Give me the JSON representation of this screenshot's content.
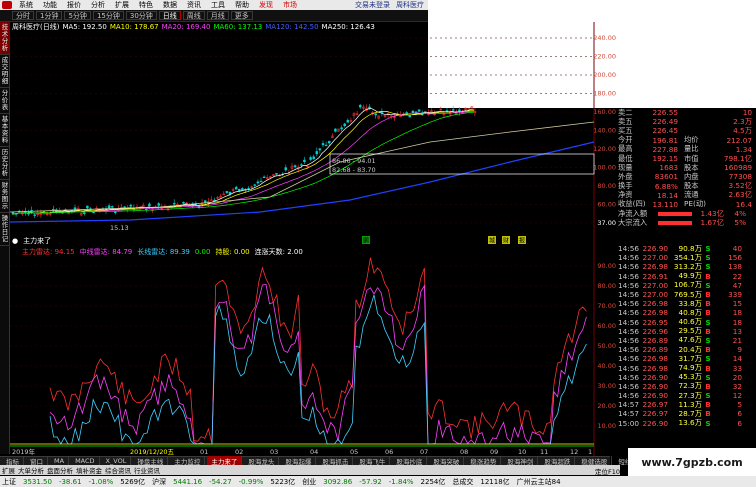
{
  "menu": {
    "items": [
      "系统",
      "功能",
      "报价",
      "分析",
      "扩展",
      "特色",
      "数据",
      "资讯",
      "工具",
      "帮助",
      "发现",
      "市场"
    ],
    "hot_items": [
      "发现",
      "市场"
    ],
    "right": [
      "交易未登录",
      "周科医疗"
    ]
  },
  "toolbar": {
    "periods": [
      "分时",
      "1分钟",
      "5分钟",
      "15分钟",
      "30分钟",
      "日线",
      "周线",
      "月线",
      "更多"
    ],
    "active": "日线"
  },
  "left_tabs": [
    "技术分析",
    "成交明细",
    "分价表",
    "基本资料",
    "历史分析",
    "财务图示",
    "操作日记"
  ],
  "price_legend": {
    "name": "周科医疗(日线)",
    "ma5": "MA5: 192.50",
    "ma10": "MA10: 178.67",
    "ma20": "MA20: 169.40",
    "ma60": "MA60: 137.13",
    "ma120": "MA120: 142.50",
    "ma250": "MA250: 126.43"
  },
  "price_axis": [
    "240.00",
    "220.00",
    "200.00",
    "180.00",
    "160.00",
    "140.00",
    "120.00",
    "100.00",
    "80.00",
    "60.00",
    "37.00"
  ],
  "annotations": [
    "86.86 - 94.01",
    "82.68 - 83.70",
    "15.13"
  ],
  "indicator_legend": {
    "title": "主力来了",
    "items": [
      {
        "label": "主力雷达:",
        "value": "94.15",
        "color": "#ff3030"
      },
      {
        "label": "中线雷达:",
        "value": "84.79",
        "color": "#ff40ff"
      },
      {
        "label": "长线雷达:",
        "value": "89.39",
        "color": "#40d0ff"
      },
      {
        "label": "0.00",
        "value": "",
        "color": "#00ff00"
      },
      {
        "label": "持股:",
        "value": "0.00",
        "color": "#ffff00"
      },
      {
        "label": "连涨天数:",
        "value": "2.00",
        "color": "#ffffff"
      }
    ],
    "markers": [
      "鹏",
      "城",
      "财",
      "报"
    ]
  },
  "indicator_axis": [
    "90.00",
    "80.00",
    "70.00",
    "60.00",
    "50.00",
    "40.00",
    "30.00",
    "20.00",
    "10.00"
  ],
  "date_labels": [
    "2019年",
    "2019/12/20五",
    "01",
    "02",
    "03",
    "04",
    "05",
    "06",
    "07",
    "08",
    "09",
    "10",
    "11",
    "12",
    "1"
  ],
  "quote": {
    "rows": [
      {
        "k": "卖二",
        "v1": "226.55",
        "v2": "10"
      },
      {
        "k": "卖五",
        "v1": "226.49",
        "v2": "2.3万"
      },
      {
        "k": "买五",
        "v1": "226.45",
        "v2": "4.5万"
      },
      {
        "k": "今开",
        "v1": "196.81",
        "k2": "均价",
        "v2": "212.07"
      },
      {
        "k": "最高",
        "v1": "227.88",
        "k2": "量比",
        "v2": "1.34"
      },
      {
        "k": "最低",
        "v1": "192.15",
        "k2": "市值",
        "v2": "798.1亿"
      },
      {
        "k": "现量",
        "v1": "1683",
        "k2": "股本",
        "v2": "160989"
      },
      {
        "k": "外盘",
        "v1": "83601",
        "k2": "内盘",
        "v2": "77308"
      },
      {
        "k": "换手",
        "v1": "6.88%",
        "k2": "股本",
        "v2": "3.52亿"
      },
      {
        "k": "净资",
        "v1": "18.14",
        "k2": "流通",
        "v2": "2.63亿"
      },
      {
        "k": "收益(四)",
        "v1": "13.110",
        "k2": "PE(动)",
        "v2": "16.4"
      }
    ],
    "flow": [
      {
        "k": "净流入额",
        "v": "1.43亿",
        "pct": "4%"
      },
      {
        "k": "大宗流入",
        "v": "1.67亿",
        "pct": "5%"
      }
    ]
  },
  "trades": [
    {
      "t": "14:56",
      "p": "226.90",
      "v": "90.8万",
      "d": "S",
      "n": "40"
    },
    {
      "t": "14:56",
      "p": "227.00",
      "v": "354.1万",
      "d": "S",
      "n": "156"
    },
    {
      "t": "14:56",
      "p": "226.98",
      "v": "313.2万",
      "d": "S",
      "n": "138"
    },
    {
      "t": "14:56",
      "p": "226.91",
      "v": "49.9万",
      "d": "B",
      "n": "22"
    },
    {
      "t": "14:56",
      "p": "227.00",
      "v": "106.7万",
      "d": "S",
      "n": "47"
    },
    {
      "t": "14:56",
      "p": "227.00",
      "v": "769.5万",
      "d": "B",
      "n": "339"
    },
    {
      "t": "14:56",
      "p": "226.98",
      "v": "33.8万",
      "d": "B",
      "n": "15"
    },
    {
      "t": "14:56",
      "p": "226.98",
      "v": "40.8万",
      "d": "B",
      "n": "18"
    },
    {
      "t": "14:56",
      "p": "226.95",
      "v": "40.6万",
      "d": "S",
      "n": "18"
    },
    {
      "t": "14:56",
      "p": "226.96",
      "v": "29.5万",
      "d": "B",
      "n": "13"
    },
    {
      "t": "14:56",
      "p": "226.89",
      "v": "47.6万",
      "d": "S",
      "n": "21"
    },
    {
      "t": "14:56",
      "p": "226.89",
      "v": "20.4万",
      "d": "B",
      "n": "9"
    },
    {
      "t": "14:56",
      "p": "226.98",
      "v": "31.7万",
      "d": "S",
      "n": "14"
    },
    {
      "t": "14:56",
      "p": "226.98",
      "v": "74.9万",
      "d": "B",
      "n": "33"
    },
    {
      "t": "14:56",
      "p": "226.90",
      "v": "45.3万",
      "d": "S",
      "n": "20"
    },
    {
      "t": "14:56",
      "p": "226.90",
      "v": "72.3万",
      "d": "B",
      "n": "32"
    },
    {
      "t": "14:56",
      "p": "226.90",
      "v": "27.3万",
      "d": "S",
      "n": "12"
    },
    {
      "t": "14:57",
      "p": "226.97",
      "v": "11.3万",
      "d": "B",
      "n": "5"
    },
    {
      "t": "14:57",
      "p": "226.97",
      "v": "28.7万",
      "d": "B",
      "n": "6"
    },
    {
      "t": "15:00",
      "p": "226.90",
      "v": "13.6万",
      "d": "S",
      "n": "6"
    }
  ],
  "tabbar_bottom": [
    "指标",
    "窗口",
    "MA",
    "MACD",
    "X_VOL",
    "操盘主线",
    "主力监控",
    "主力来了",
    "股海龙头",
    "股海起爆",
    "股海抓击",
    "股海飞牛",
    "股海抄底",
    "股海突破",
    "稳涨趋势",
    "股海神剑",
    "股海超跌",
    "稳健选股",
    "短线主图",
    "黑马"
  ],
  "tabbar_top": [
    "扩展",
    "大单分析",
    "盘面分析",
    "填补资金",
    "综合资讯",
    "行业资讯"
  ],
  "active_tab": "主力来了",
  "status": {
    "items": [
      {
        "label": "上证",
        "value": "3531.50",
        "chg": "-38.61",
        "pct": "-1.08%",
        "amt": "5269亿",
        "dir": "dn"
      },
      {
        "label": "沪深",
        "value": "5441.16",
        "chg": "-54.27",
        "pct": "-0.99%",
        "amt": "5223亿",
        "dir": "dn"
      },
      {
        "label": "创业",
        "value": "3092.86",
        "chg": "-57.92",
        "pct": "-1.84%",
        "amt": "2254亿",
        "dir": "dn"
      }
    ],
    "extra": "总成交",
    "extra_value": "12118亿",
    "site": "广州云主站84"
  },
  "footer_note": "定位F10 供参考",
  "watermark": "www.7gpzb.com",
  "colors": {
    "up": "#ff3030",
    "down": "#00c000",
    "ma5": "#ffffff",
    "ma10": "#ffff00",
    "ma20": "#ff40ff",
    "ma60": "#00ff00",
    "ma120": "#4060ff",
    "ma250": "#ffffff"
  }
}
